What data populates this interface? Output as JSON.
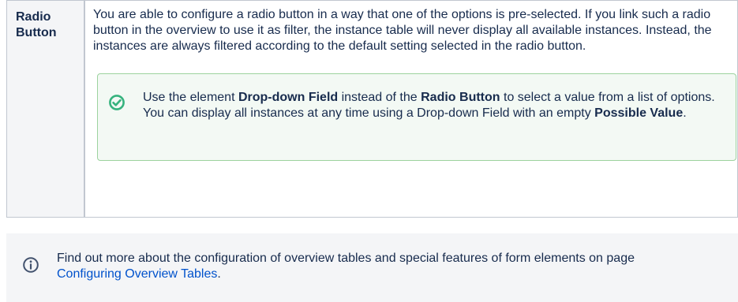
{
  "table": {
    "header": "Radio Button",
    "description": "You are able to configure a radio button in a way that one of the options is pre-selected. If you link such a radio button in the overview to use it as filter, the instance table will never display all available instances. Instead, the instances are always filtered according to the default setting selected in the radio button.",
    "tip": {
      "icon": "check-circle-icon",
      "part1": "Use the element ",
      "bold1": "Drop-down Field",
      "part2": " instead of the ",
      "bold2": "Radio Button",
      "part3": " to select a value from a list of options. You can display all instances at any time using a Drop-down Field with an empty ",
      "bold3": "Possible Value",
      "part4": "."
    }
  },
  "info": {
    "icon": "info-icon",
    "text_before": "Find out more about the configuration of overview tables and special features of form elements on page ",
    "link_text": "Configuring Overview Tables",
    "text_after": "."
  },
  "colors": {
    "tip_icon": "#36b37e",
    "info_icon": "#42526e",
    "link": "#0052cc"
  }
}
